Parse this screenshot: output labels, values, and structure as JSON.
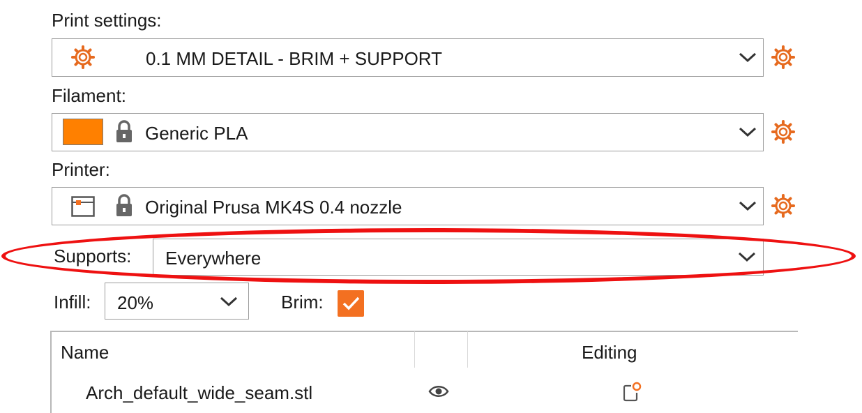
{
  "print_settings": {
    "label": "Print settings:",
    "value": "0.1 MM DETAIL - BRIM + SUPPORT"
  },
  "filament": {
    "label": "Filament:",
    "value": "Generic PLA",
    "swatch_color": "#ff8000"
  },
  "printer": {
    "label": "Printer:",
    "value": "Original Prusa MK4S 0.4 nozzle"
  },
  "supports": {
    "label": "Supports:",
    "value": "Everywhere"
  },
  "infill": {
    "label": "Infill:",
    "value": "20%"
  },
  "brim": {
    "label": "Brim:",
    "checked": true
  },
  "object_list": {
    "columns": {
      "name": "Name",
      "editing": "Editing"
    },
    "rows": [
      {
        "name": "Arch_default_wide_seam.stl"
      }
    ]
  },
  "colors": {
    "accent": "#f37021",
    "annotation": "#ee1111",
    "gear": "#e66a1f"
  },
  "icons": {
    "preset_gear": "gear-icon",
    "lock": "lock-icon",
    "printer": "printer-icon",
    "visibility": "eye-icon",
    "edit": "edit-settings-icon"
  }
}
